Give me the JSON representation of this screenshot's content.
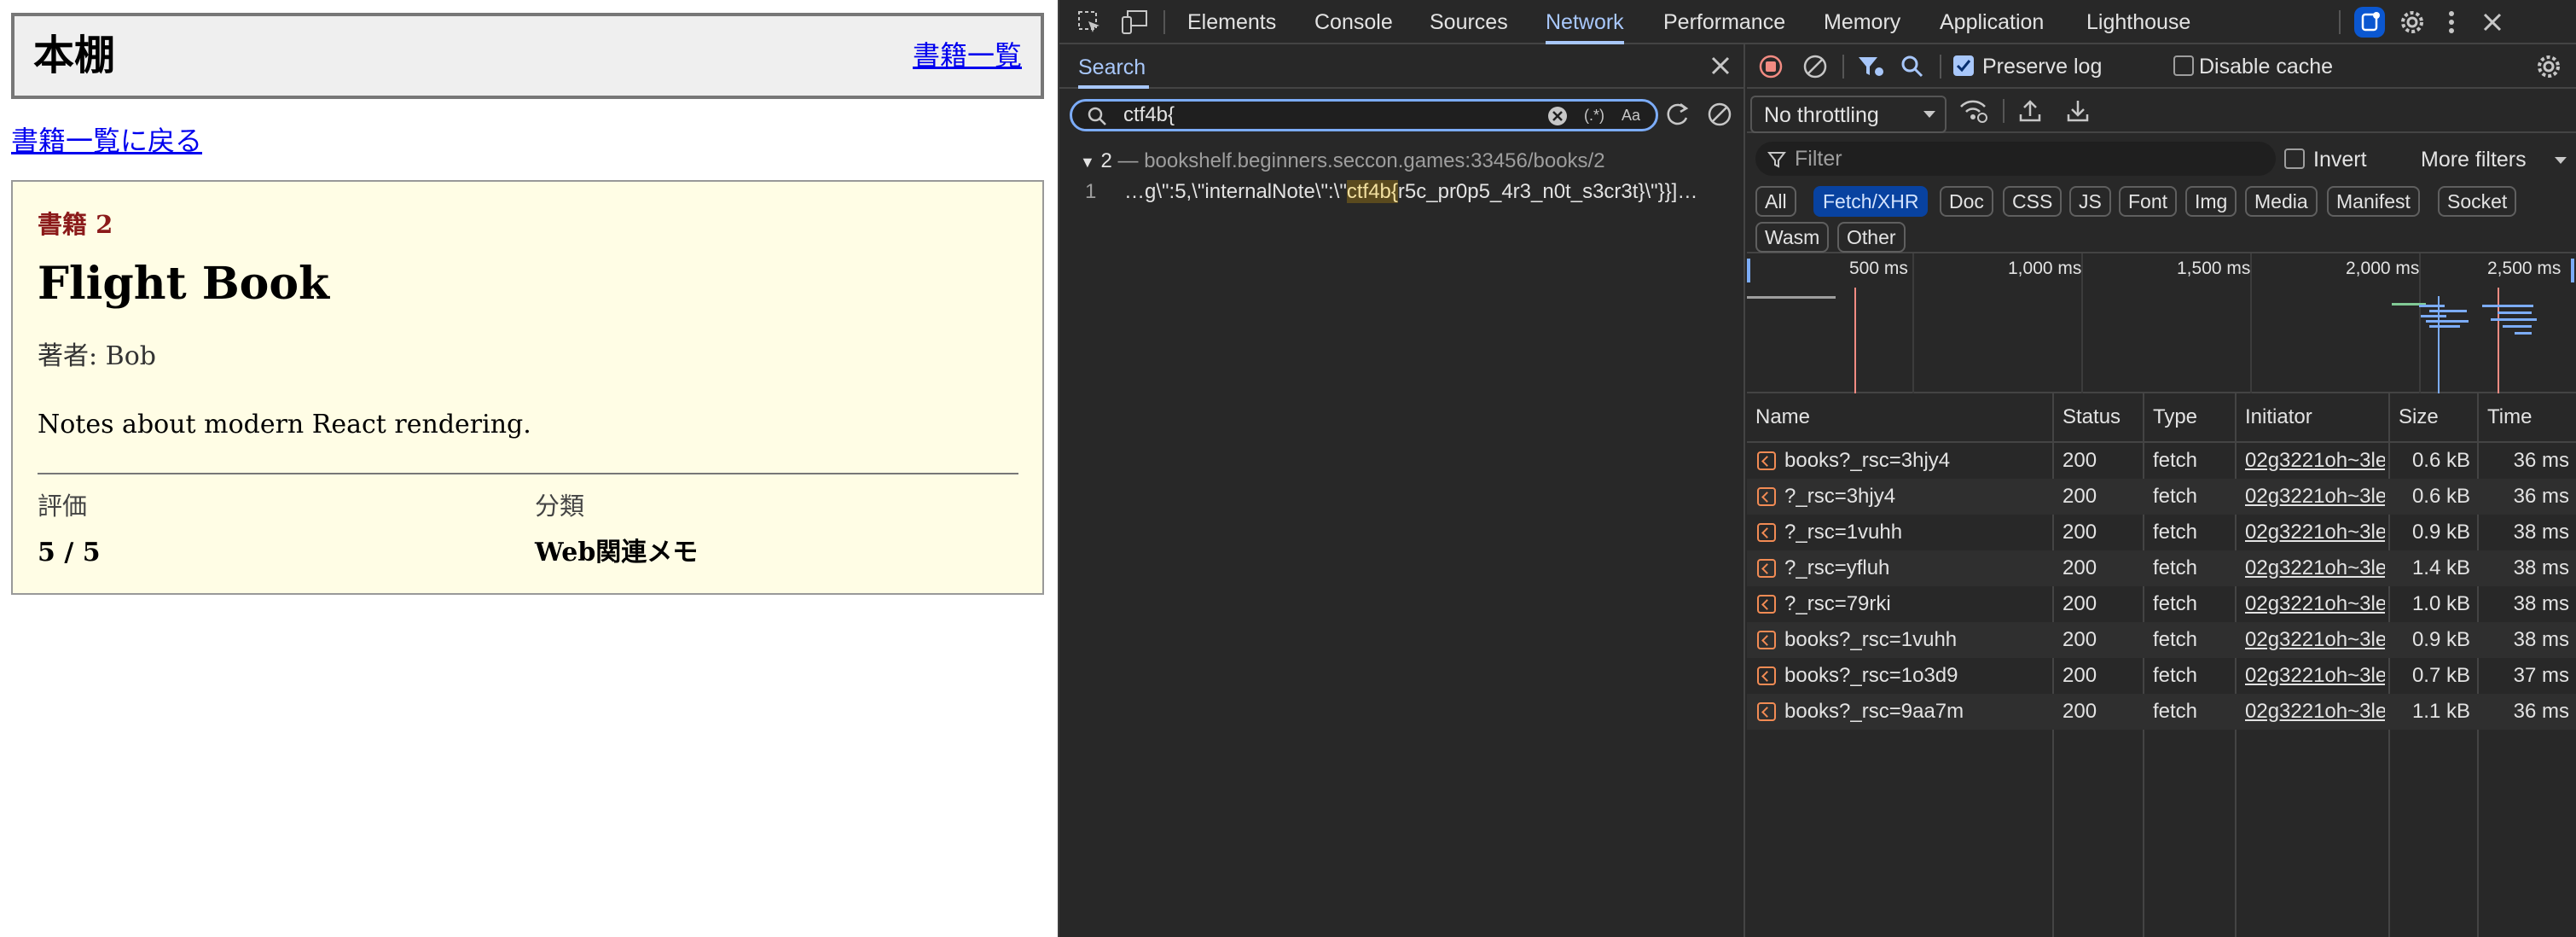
{
  "page": {
    "site_title": "本棚",
    "nav_link": "書籍一覧",
    "back_link": "書籍一覧に戻る",
    "book": {
      "number": "書籍 2",
      "title": "Flight Book",
      "author": "著者: Bob",
      "notes": "Notes about modern React rendering.",
      "rating_label": "評価",
      "rating_value": "5 / 5",
      "category_label": "分類",
      "category_value": "Web関連メモ"
    }
  },
  "devtools": {
    "tabs": [
      "Elements",
      "Console",
      "Sources",
      "Network",
      "Performance",
      "Memory",
      "Application",
      "Lighthouse"
    ],
    "active_tab": "Network",
    "accent": "#a8c7fa",
    "search": {
      "title": "Search",
      "query": "ctf4b{",
      "regex_label": "(.*)",
      "case_label": "Aa",
      "result_count": "2",
      "result_file": "bookshelf.beginners.seccon.games:33456/books/2",
      "line_number": "1",
      "match_prefix": "…g\\\":5,\\\"internalNote\\\":\\\"",
      "match_text": "ctf4b{",
      "match_suffix": "r5c_pr0p5_4r3_n0t_s3cr3t}\\\"}}]…"
    },
    "network": {
      "preserve_log": "Preserve log",
      "disable_cache": "Disable cache",
      "throttling": "No throttling",
      "filter_placeholder": "Filter",
      "invert": "Invert",
      "more_filters": "More filters",
      "chips": [
        "All",
        "Fetch/XHR",
        "Doc",
        "CSS",
        "JS",
        "Font",
        "Img",
        "Media",
        "Manifest",
        "Socket",
        "Wasm",
        "Other"
      ],
      "active_chip": "Fetch/XHR",
      "timeline_ticks": [
        "500 ms",
        "1,000 ms",
        "1,500 ms",
        "2,000 ms",
        "2,500 ms"
      ],
      "columns": [
        "Name",
        "Status",
        "Type",
        "Initiator",
        "Size",
        "Time"
      ],
      "rows": [
        {
          "name": "books?_rsc=3hjy4",
          "status": "200",
          "type": "fetch",
          "initiator": "02g3221oh~3le",
          "size": "0.6 kB",
          "time": "36 ms"
        },
        {
          "name": "?_rsc=3hjy4",
          "status": "200",
          "type": "fetch",
          "initiator": "02g3221oh~3le",
          "size": "0.6 kB",
          "time": "36 ms"
        },
        {
          "name": "?_rsc=1vuhh",
          "status": "200",
          "type": "fetch",
          "initiator": "02g3221oh~3le",
          "size": "0.9 kB",
          "time": "38 ms"
        },
        {
          "name": "?_rsc=yfluh",
          "status": "200",
          "type": "fetch",
          "initiator": "02g3221oh~3le",
          "size": "1.4 kB",
          "time": "38 ms"
        },
        {
          "name": "?_rsc=79rki",
          "status": "200",
          "type": "fetch",
          "initiator": "02g3221oh~3le",
          "size": "1.0 kB",
          "time": "38 ms"
        },
        {
          "name": "books?_rsc=1vuhh",
          "status": "200",
          "type": "fetch",
          "initiator": "02g3221oh~3le",
          "size": "0.9 kB",
          "time": "38 ms"
        },
        {
          "name": "books?_rsc=1o3d9",
          "status": "200",
          "type": "fetch",
          "initiator": "02g3221oh~3le",
          "size": "0.7 kB",
          "time": "37 ms"
        },
        {
          "name": "books?_rsc=9aa7m",
          "status": "200",
          "type": "fetch",
          "initiator": "02g3221oh~3le",
          "size": "1.1 kB",
          "time": "36 ms"
        }
      ]
    }
  }
}
